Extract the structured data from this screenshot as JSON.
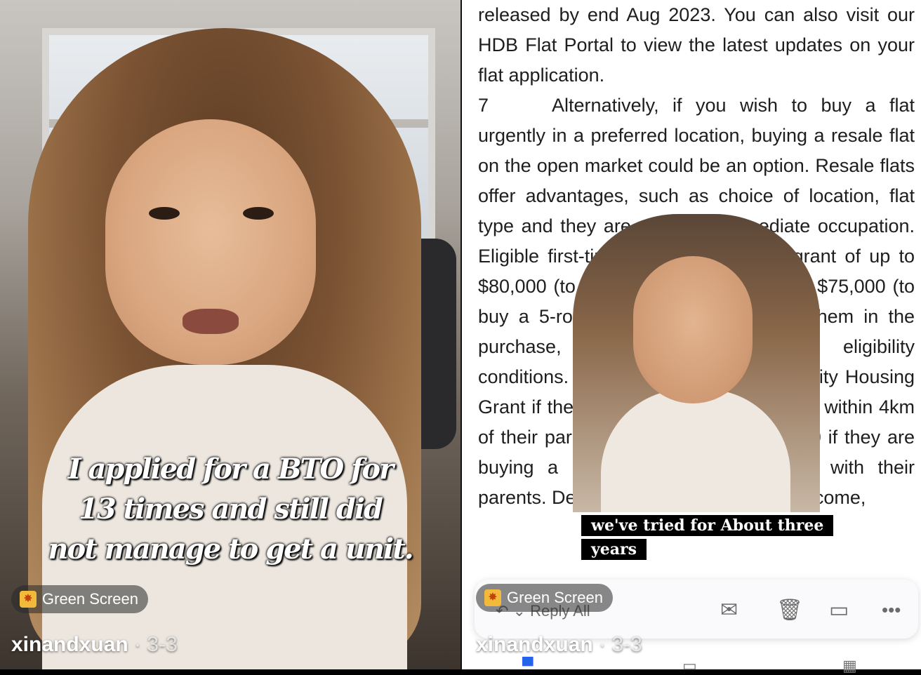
{
  "left": {
    "caption": [
      "I applied for a BTO for",
      "13 times and still did",
      "not manage to get a unit."
    ],
    "effect_label": "Green Screen",
    "username": "xinandxuan",
    "separator": "·",
    "post_index": "3-3"
  },
  "right": {
    "document": {
      "para1": "released by end Aug 2023. You can also visit our HDB Flat Portal to view the latest updates on your flat application.",
      "para2_number": "7",
      "para2_text": "Alternatively, if you wish to buy a flat urgently in a preferred location, buying a resale flat on the open market could be an option. Resale flats offer advantages, such as choice of location, flat type and they are ready for immediate occupation. Eligible first-timers may apply for a grant of up to $80,000 (to buy up to a 4-room flat) or $75,000 (to buy a 5-room or bigger flat) to help them in the purchase, subject to meeting the eligibility conditions. They may also get a Proximity Housing Grant if they buy the resale flat they live within 4km of their parents' home, or up to $30,000 if they are buying a resale flat to live together with their parents. Depending on the household income,"
    },
    "inset_caption": [
      "we've tried for About three",
      "years"
    ],
    "effect_label": "Green Screen",
    "reply_label": "Reply All",
    "username": "xinandxuan",
    "separator": "·",
    "post_index": "3-3",
    "mail_actions": [
      "envelope-icon",
      "trash-icon",
      "archive-icon",
      "more-icon"
    ]
  },
  "colors": {
    "accent": "#2563eb",
    "badge": "#f3b93b"
  }
}
